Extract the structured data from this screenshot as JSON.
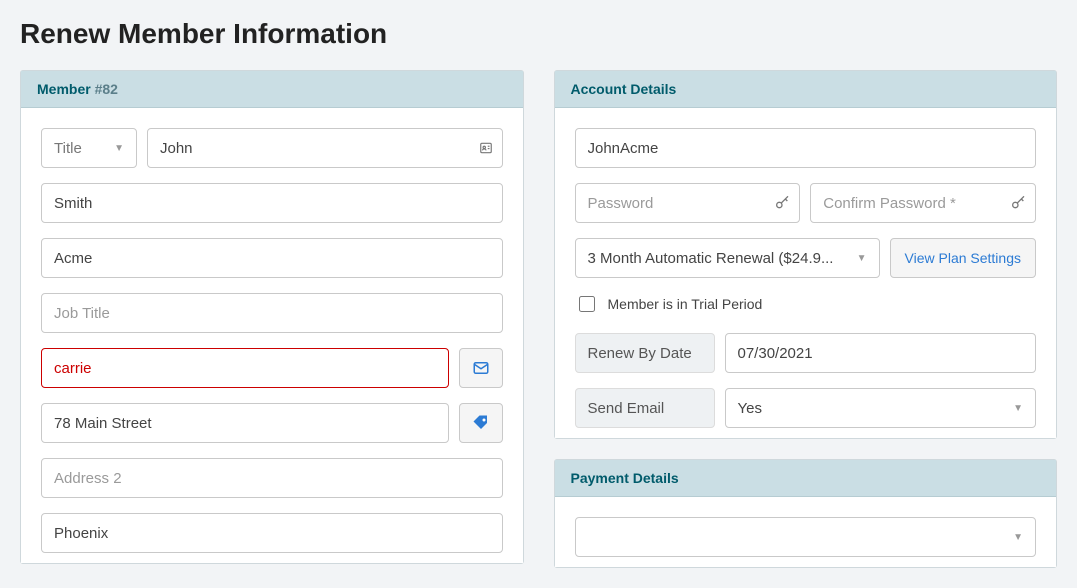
{
  "page_title": "Renew Member Information",
  "member": {
    "header_prefix": "Member ",
    "header_num": "#82",
    "title_placeholder": "Title",
    "first_name": "John",
    "last_name": "Smith",
    "company": "Acme",
    "job_title_placeholder": "Job Title",
    "email": "carrie",
    "address1": "78 Main Street",
    "address2_placeholder": "Address 2",
    "city": "Phoenix"
  },
  "account": {
    "header": "Account Details",
    "username": "JohnAcme",
    "password_placeholder": "Password",
    "confirm_password_placeholder": "Confirm Password *",
    "plan": "3 Month Automatic Renewal ($24.9...",
    "view_plan_settings": "View Plan Settings",
    "trial_label": "Member is in Trial Period",
    "renew_by_label": "Renew By Date",
    "renew_by_date": "07/30/2021",
    "send_email_label": "Send Email",
    "send_email_value": "Yes"
  },
  "payment": {
    "header": "Payment Details"
  }
}
